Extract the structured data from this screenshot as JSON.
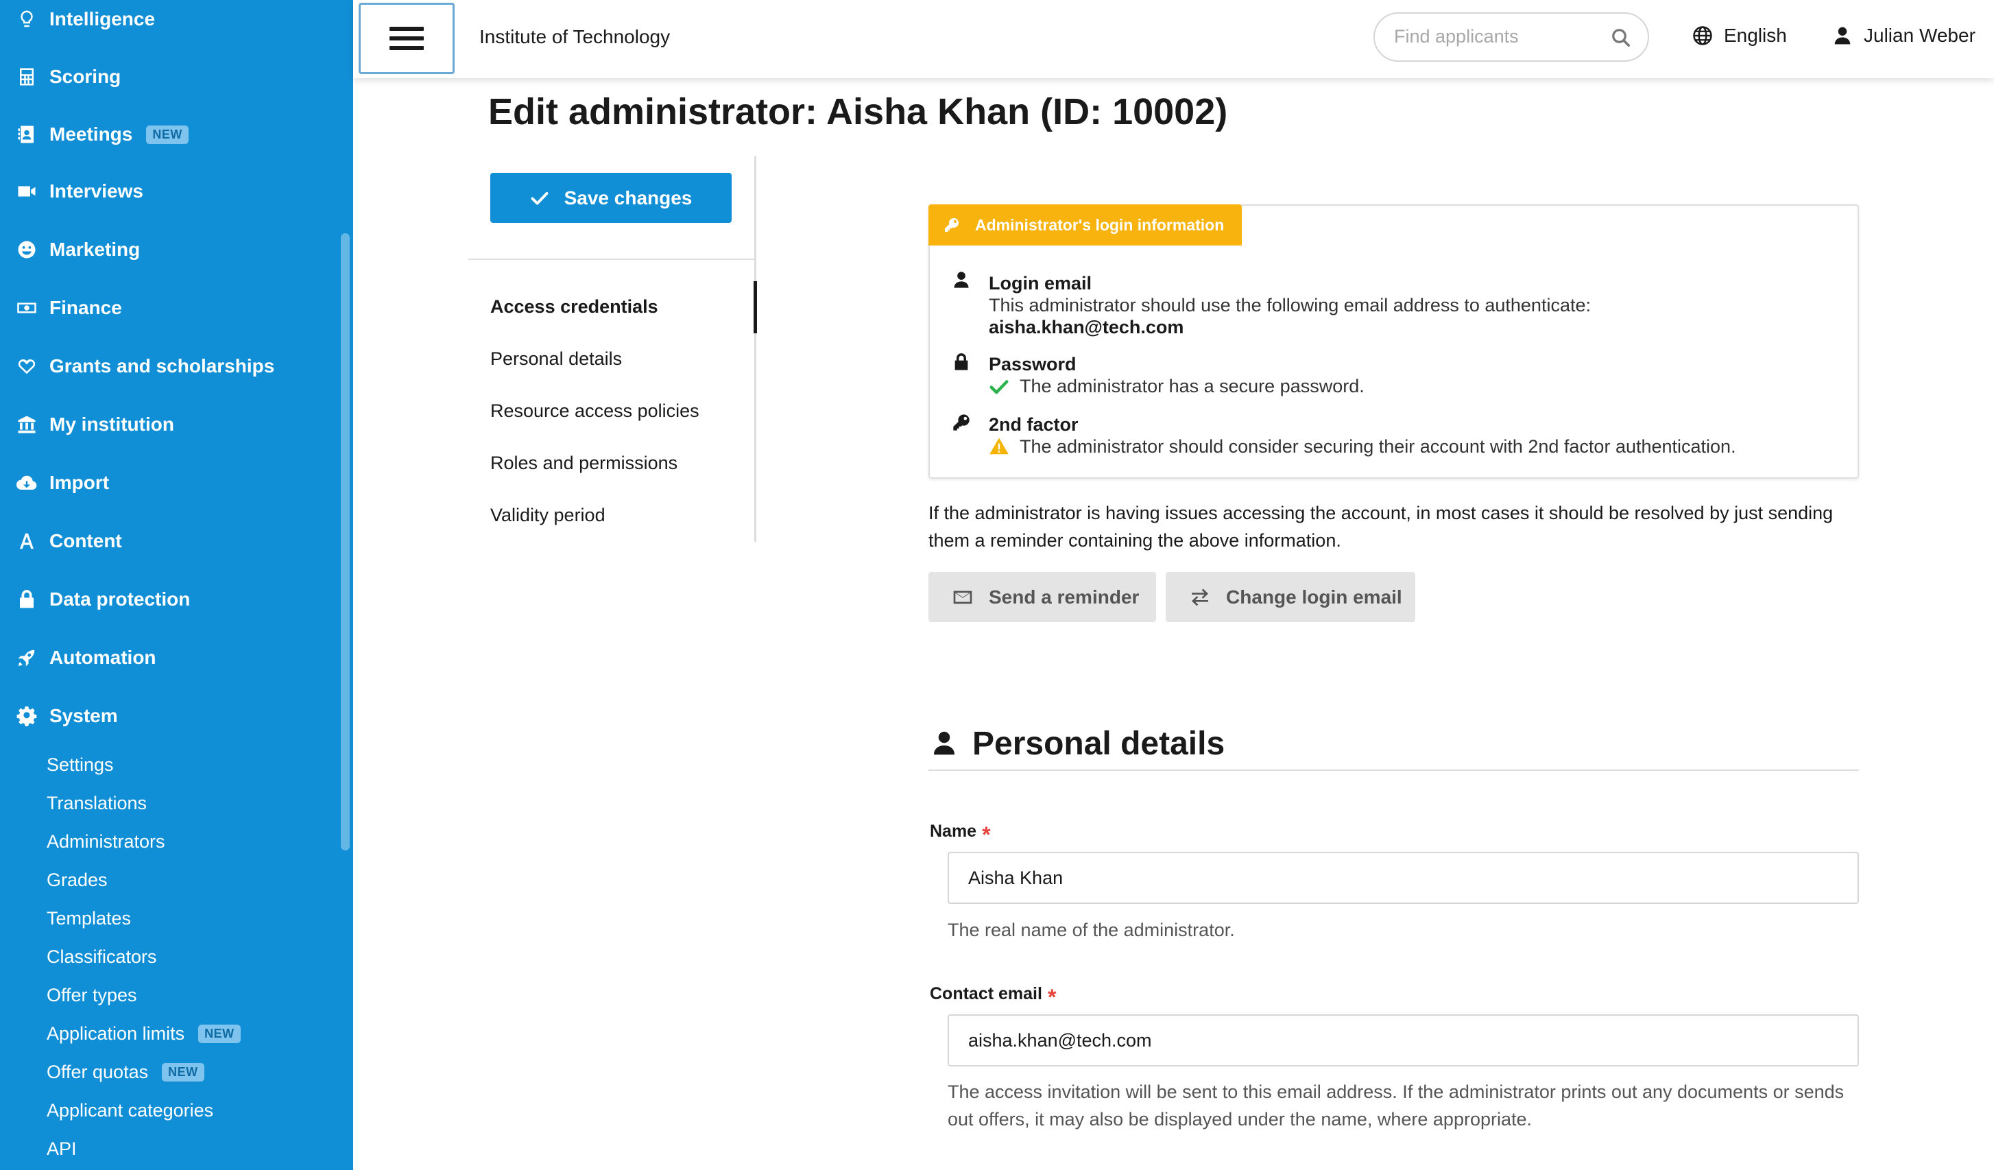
{
  "sidebar": {
    "items": [
      {
        "label": "Intelligence",
        "icon": "lightbulb-icon"
      },
      {
        "label": "Scoring",
        "icon": "calculator-icon"
      },
      {
        "label": "Meetings",
        "icon": "address-book-icon",
        "badge": "NEW"
      },
      {
        "label": "Interviews",
        "icon": "video-camera-icon"
      },
      {
        "label": "Marketing",
        "icon": "smile-icon"
      },
      {
        "label": "Finance",
        "icon": "money-bill-icon"
      },
      {
        "label": "Grants and scholarships",
        "icon": "heart-icon"
      },
      {
        "label": "My institution",
        "icon": "institution-icon"
      },
      {
        "label": "Import",
        "icon": "cloud-download-icon"
      },
      {
        "label": "Content",
        "icon": "font-icon"
      },
      {
        "label": "Data protection",
        "icon": "lock-icon"
      },
      {
        "label": "Automation",
        "icon": "rocket-icon"
      },
      {
        "label": "System",
        "icon": "gear-icon"
      }
    ],
    "system_subitems": [
      {
        "label": "Settings"
      },
      {
        "label": "Translations"
      },
      {
        "label": "Administrators"
      },
      {
        "label": "Grades"
      },
      {
        "label": "Templates"
      },
      {
        "label": "Classificators"
      },
      {
        "label": "Offer types"
      },
      {
        "label": "Application limits",
        "badge": "NEW"
      },
      {
        "label": "Offer quotas",
        "badge": "NEW"
      },
      {
        "label": "Applicant categories"
      },
      {
        "label": "API"
      }
    ]
  },
  "header": {
    "org_name": "Institute of Technology",
    "search_placeholder": "Find applicants",
    "language": "English",
    "user_name": "Julian Weber"
  },
  "page": {
    "title": "Edit administrator: Aisha Khan (ID: 10002)",
    "save_label": "Save changes",
    "section_nav": [
      {
        "label": "Access credentials",
        "active": true
      },
      {
        "label": "Personal details"
      },
      {
        "label": "Resource access policies"
      },
      {
        "label": "Roles and permissions"
      },
      {
        "label": "Validity period"
      }
    ]
  },
  "login_info": {
    "tab_label": "Administrator's login information",
    "email_title": "Login email",
    "email_desc": "This administrator should use the following email address to authenticate:",
    "email_value": "aisha.khan@tech.com",
    "password_title": "Password",
    "password_status": "The administrator has a secure password.",
    "second_factor_title": "2nd factor",
    "second_factor_status": "The administrator should consider securing their account with 2nd factor authentication.",
    "help_text": "If the administrator is having issues accessing the account, in most cases it should be resolved by just sending them a reminder containing the above information.",
    "send_reminder_label": "Send a reminder",
    "change_email_label": "Change login email"
  },
  "personal_details": {
    "heading": "Personal details",
    "name_label": "Name",
    "name_value": "Aisha Khan",
    "name_help": "The real name of the administrator.",
    "email_label": "Contact email",
    "email_value": "aisha.khan@tech.com",
    "email_help": "The access invitation will be sent to this email address. If the administrator prints out any documents or sends out offers, it may also be displayed under the name, where appropriate.",
    "required_marker": "*"
  },
  "colors": {
    "sidebar": "#118fd6",
    "primary_button": "#118fd6",
    "card_tab": "#f9b30f",
    "success": "#2bb24c",
    "warning": "#f4b400",
    "required": "#e8423a"
  }
}
